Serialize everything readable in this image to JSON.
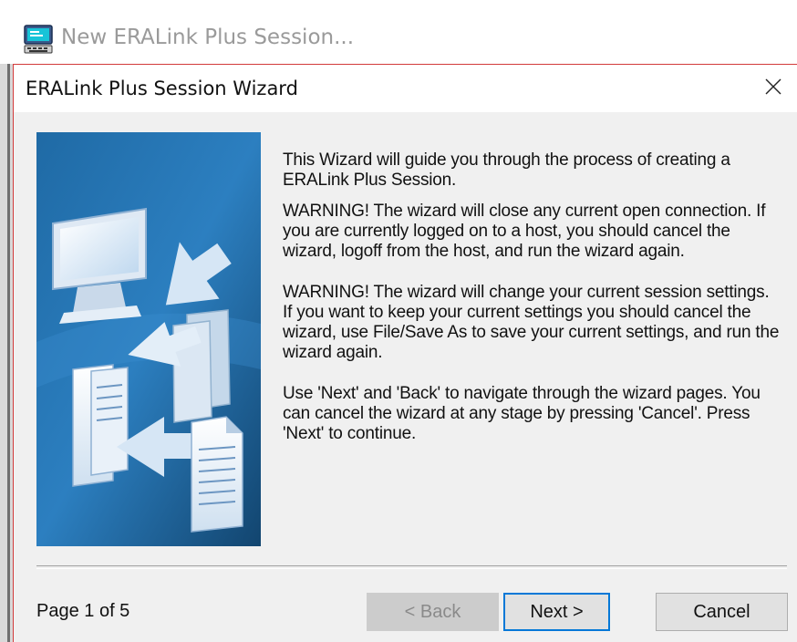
{
  "parent_window": {
    "title": "New ERALink Plus Session...",
    "icon": "terminal-computer-icon"
  },
  "dialog": {
    "title": "ERALink Plus Session Wizard",
    "close_icon": "close-icon",
    "side_image": "wizard-graphic-monitor-documents-arrows",
    "paragraphs": [
      "This Wizard will guide you through the process of creating a ERALink Plus Session.",
      "WARNING!  The wizard will close any current open connection.  If you are currently logged on to a host, you should cancel the wizard, logoff from the host, and run the wizard again.",
      "WARNING!  The wizard will change your current session settings.  If you want to keep your current settings you should cancel the wizard, use File/Save As to save your current settings, and run the wizard again.",
      "Use 'Next' and 'Back' to navigate through the wizard pages.  You can cancel the wizard at any stage by pressing 'Cancel'.  Press 'Next' to continue."
    ],
    "page_indicator": "Page 1 of 5",
    "buttons": {
      "back": "< Back",
      "next": "Next >",
      "cancel": "Cancel"
    },
    "colors": {
      "accent": "#0078d7",
      "dialog_background": "#f0f0f0",
      "side_image_blue": "#1d5f95"
    }
  }
}
